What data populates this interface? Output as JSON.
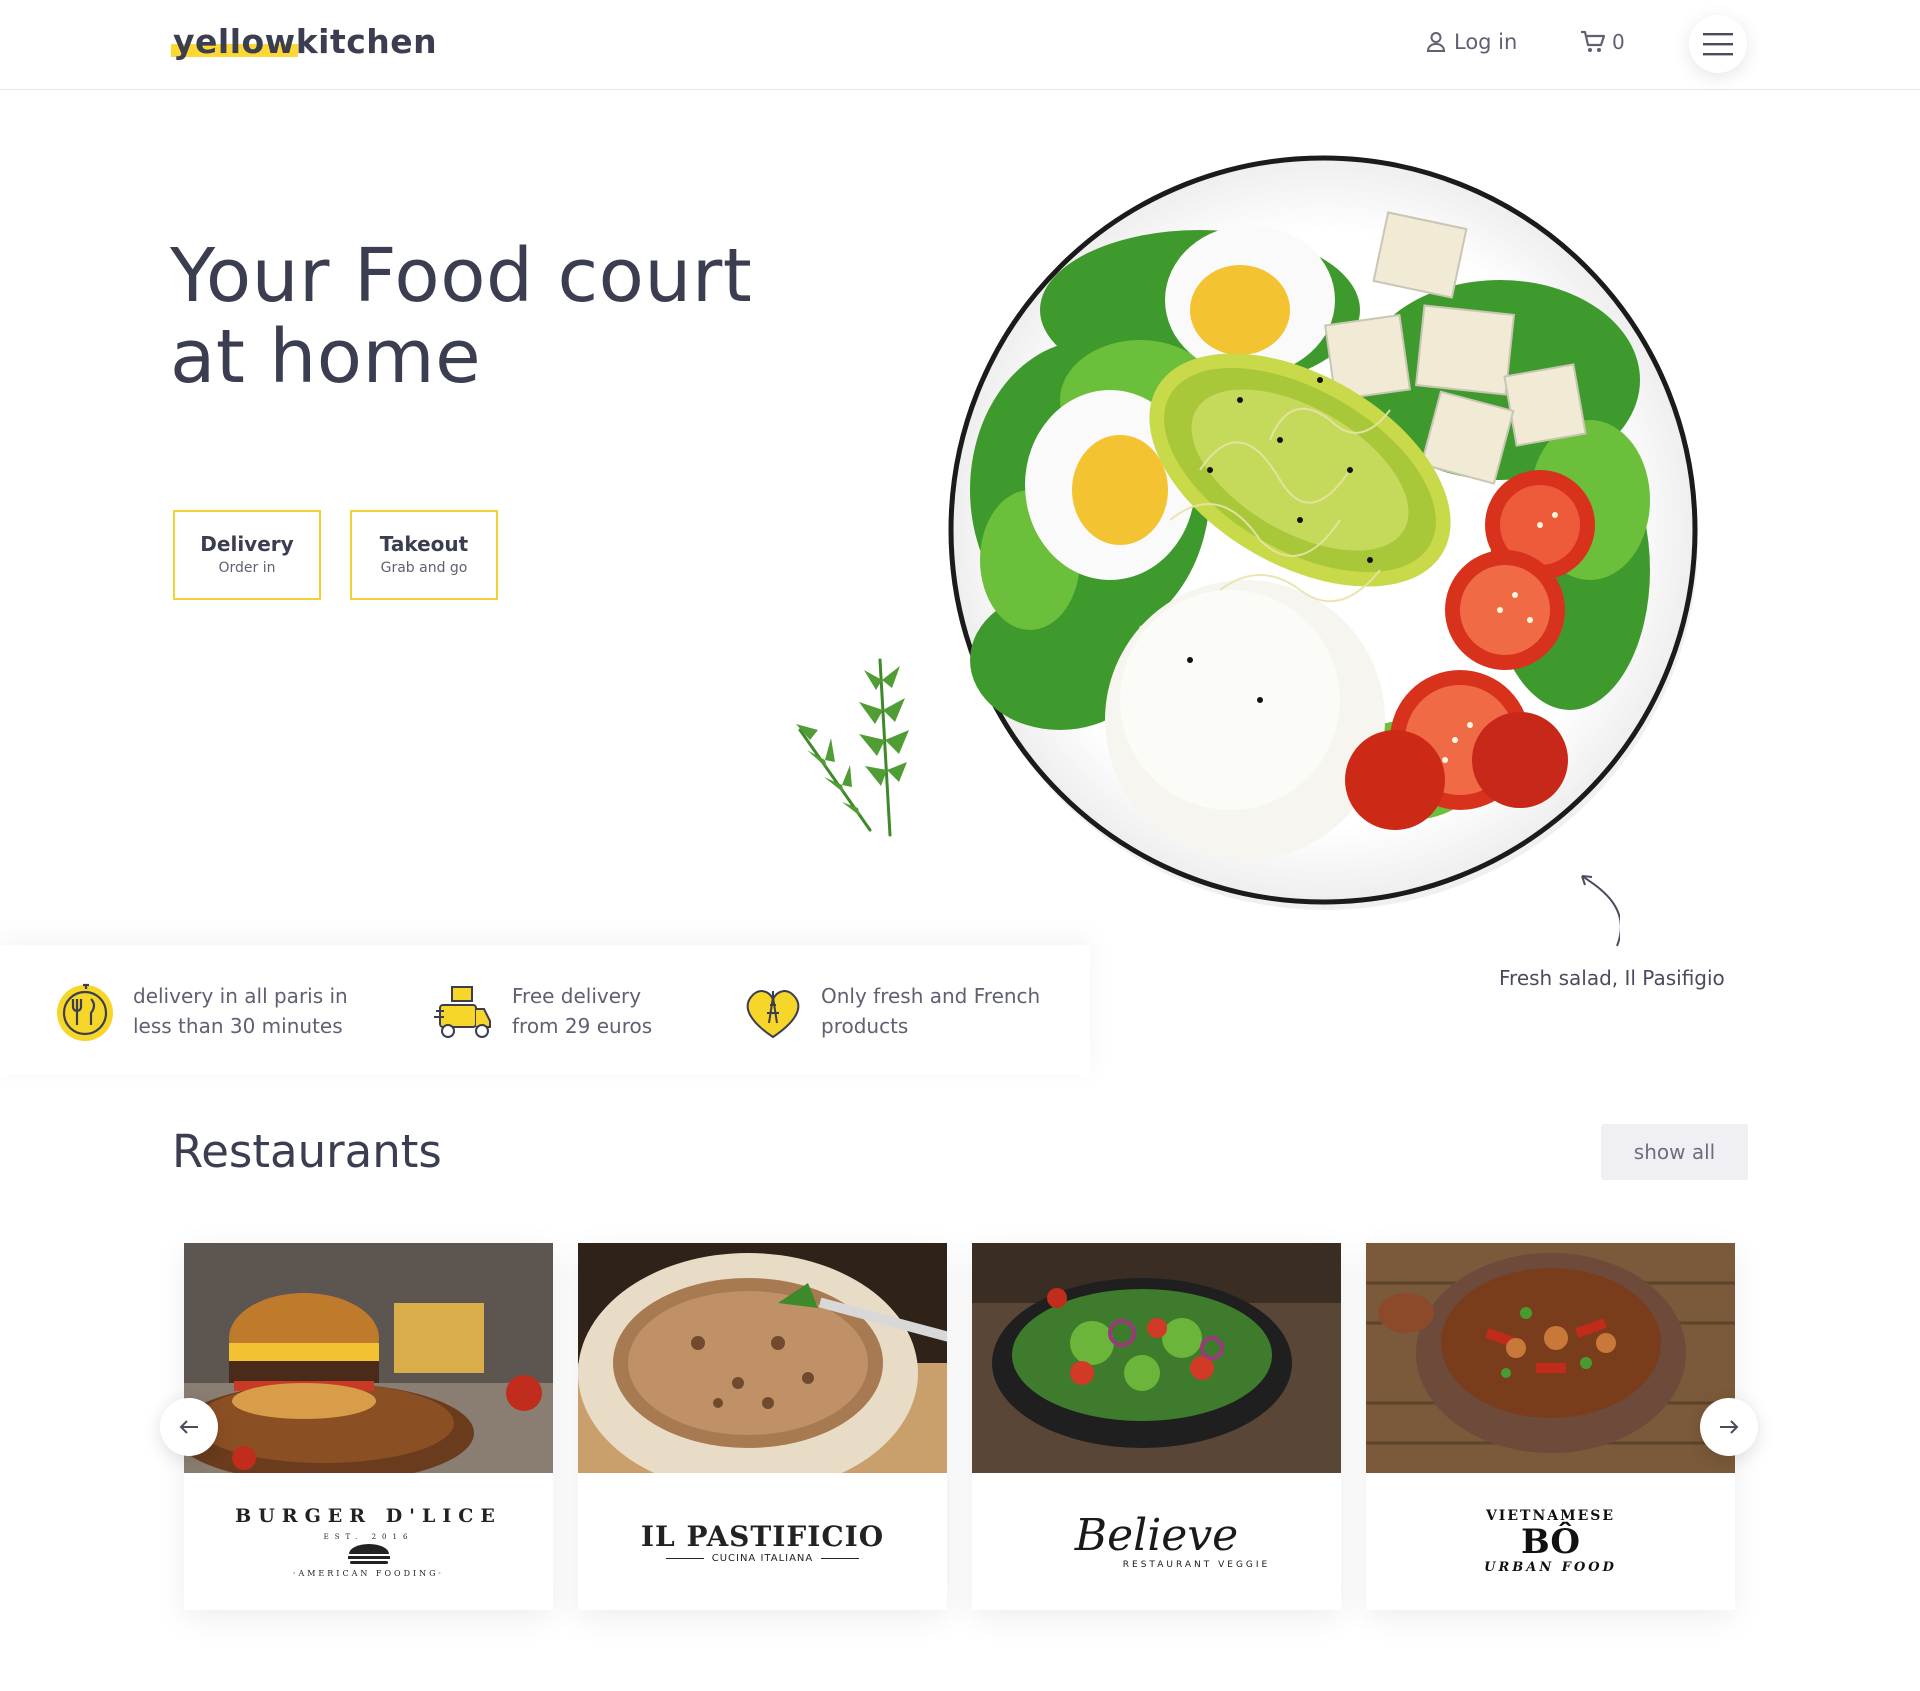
{
  "brand": {
    "highlight": "yellow",
    "rest": "kitchen",
    "accent_color": "#fdd835"
  },
  "header": {
    "login_label": "Log in",
    "cart_count": "0",
    "user_icon": "user-icon",
    "cart_icon": "cart-icon",
    "menu_icon": "hamburger-menu-icon"
  },
  "hero": {
    "title_line1": "Your Food court",
    "title_line2": "at home",
    "buttons": [
      {
        "title": "Delivery",
        "subtitle": "Order in"
      },
      {
        "title": "Takeout",
        "subtitle": "Grab and go"
      }
    ],
    "caption": "Fresh salad, Il Pasifigio"
  },
  "features": [
    {
      "icon": "clock-fork-knife-icon",
      "line1": "delivery in all paris in",
      "line2": "less than 30 minutes"
    },
    {
      "icon": "delivery-scooter-icon",
      "line1": "Free delivery",
      "line2": "from 29 euros"
    },
    {
      "icon": "heart-eiffel-tower-icon",
      "line1": "Only fresh and French",
      "line2": "products"
    }
  ],
  "restaurants": {
    "title": "Restaurants",
    "show_all_label": "show all",
    "items": [
      {
        "logo_top": "BURGER D'LICE",
        "logo_mid": "EST. 2016",
        "logo_bottom": "·AMERICAN FOODING·"
      },
      {
        "logo_top": "IL PASTIFICIO",
        "logo_bottom": "CUCINA ITALIANA"
      },
      {
        "logo_top": "Believe",
        "logo_bottom": "RESTAURANT VEGGIE"
      },
      {
        "logo_top": "VIETNAMESE",
        "logo_mid": "BÔ",
        "logo_bottom": "URBAN FOOD"
      }
    ]
  }
}
